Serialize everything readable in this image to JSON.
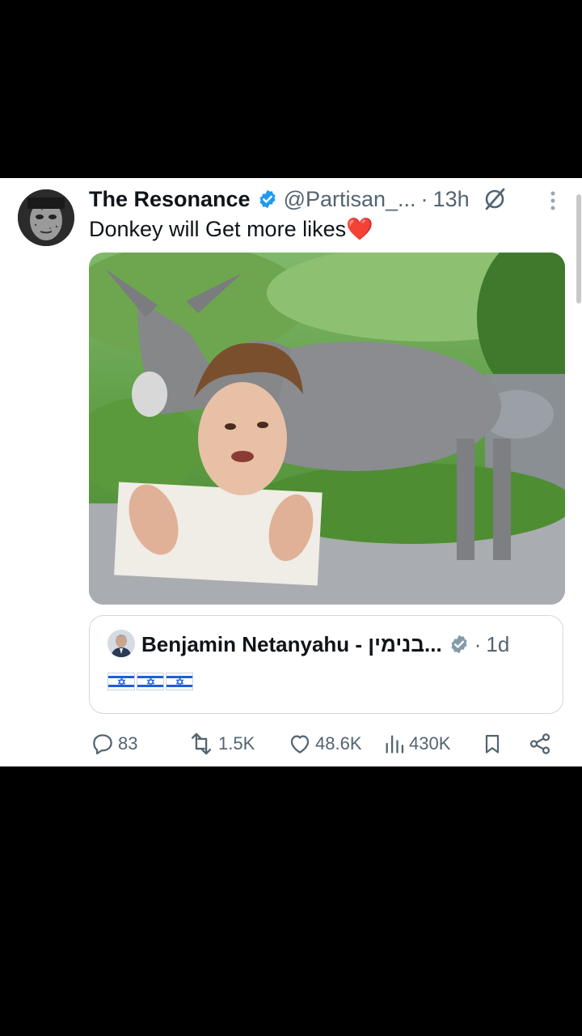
{
  "tweet": {
    "author_name": "The Resonance",
    "handle": "@Partisan_...",
    "separator": "·",
    "time": "13h",
    "text": "Donkey will Get more likes❤️",
    "avatar_icon": "user-avatar",
    "verified_icon": "verified-badge-icon",
    "grok_icon": "grok-icon",
    "more_icon": "more-vertical-icon",
    "media_icon": "donkey-photo"
  },
  "quote": {
    "author_name": "Benjamin Netanyahu - בנימין...",
    "separator": "·",
    "time": "1d",
    "flags": [
      "flag-israel",
      "flag-israel",
      "flag-israel"
    ]
  },
  "actions": {
    "replies": "83",
    "reposts": "1.5K",
    "likes": "48.6K",
    "views": "430K"
  },
  "colors": {
    "background": "#000000",
    "card": "#ffffff",
    "verified_blue": "#1d9bf0",
    "muted_text": "#536471",
    "israel_blue": "#1e5fd8"
  }
}
